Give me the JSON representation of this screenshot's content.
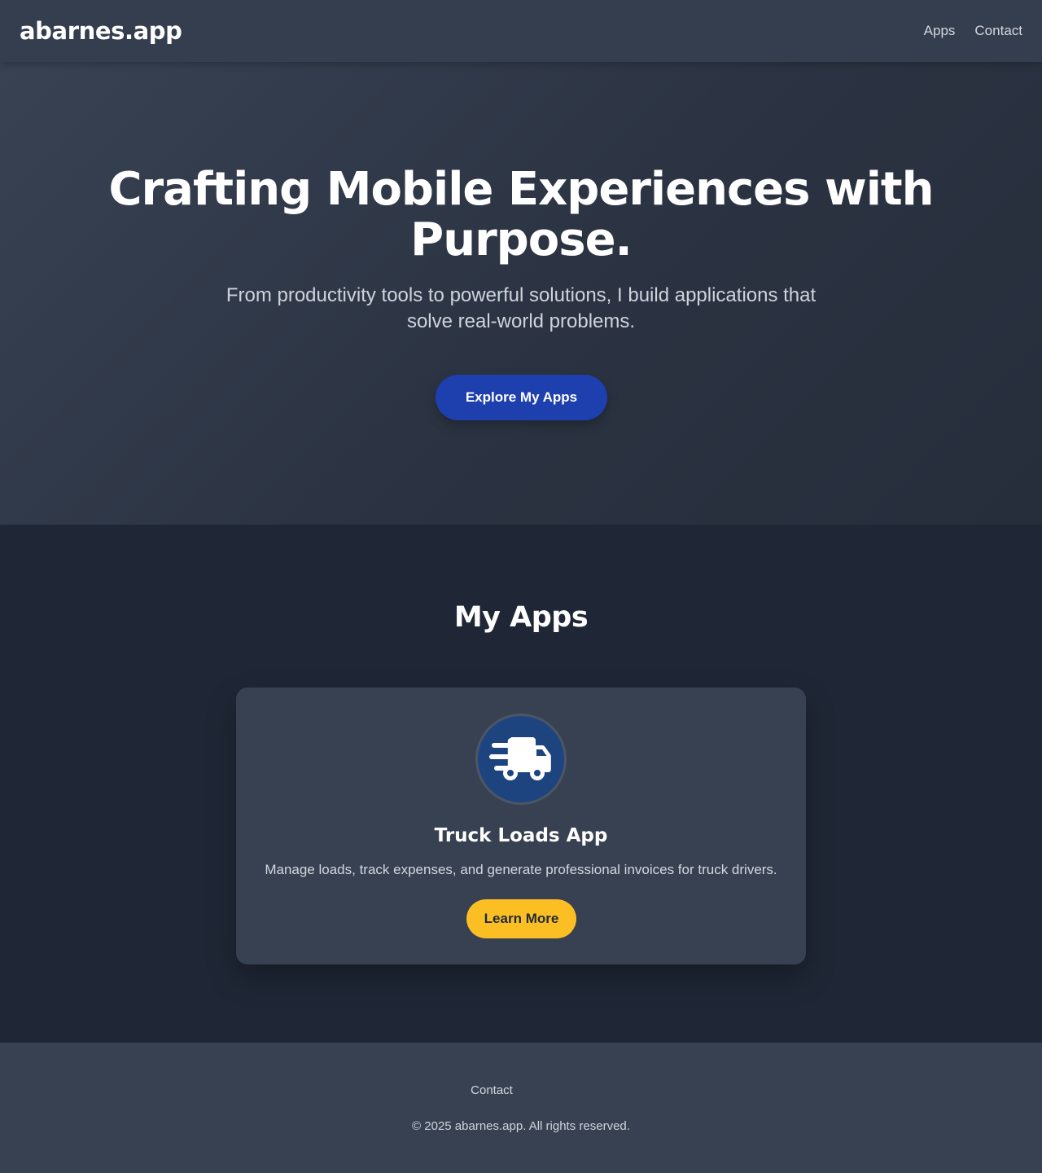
{
  "header": {
    "logo": "abarnes.app",
    "nav": [
      {
        "label": "Apps"
      },
      {
        "label": "Contact"
      }
    ]
  },
  "hero": {
    "title": "Crafting Mobile Experiences with Purpose.",
    "subtitle": "From productivity tools to powerful solutions, I build applications that solve real-world problems.",
    "cta_label": "Explore My Apps"
  },
  "apps_section": {
    "title": "My Apps",
    "apps": [
      {
        "icon": "truck-icon",
        "name": "Truck Loads App",
        "description": "Manage loads, track expenses, and generate professional invoices for truck drivers.",
        "button_label": "Learn More"
      }
    ]
  },
  "footer": {
    "contact_label": "Contact",
    "copyright": "© 2025 abarnes.app. All rights reserved."
  },
  "colors": {
    "header_bg": "#353e4e",
    "hero_button": "#1e3fae",
    "accent_button": "#fbbf24",
    "app_icon_bg": "#1e4480"
  }
}
